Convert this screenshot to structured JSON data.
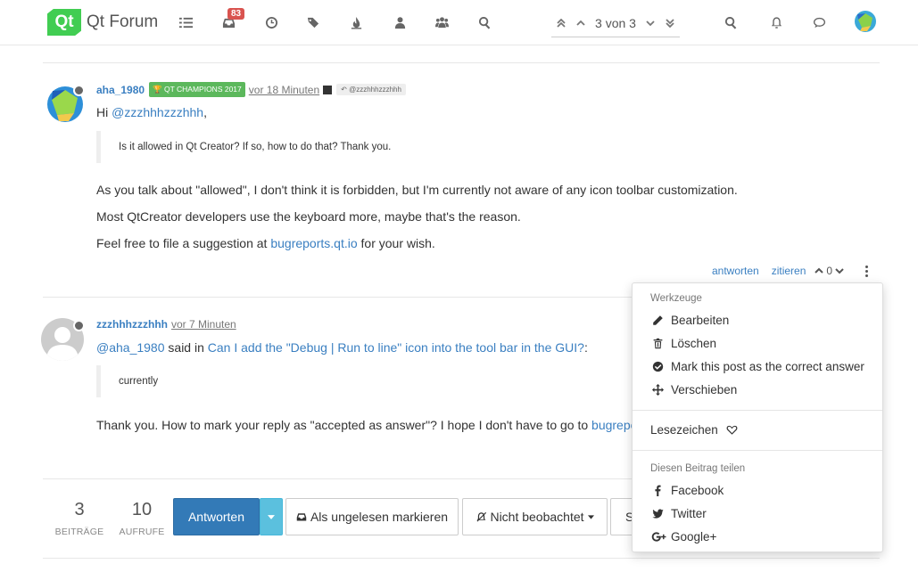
{
  "header": {
    "logo_text": "Qt",
    "brand": "Qt Forum",
    "unread_count": "83",
    "pager_text": "3 von 3"
  },
  "post1": {
    "username": "aha_1980",
    "badge": "QT CHAMPIONS 2017",
    "time": "vor 18 Minuten",
    "reply_to": "@zzzhhhzzzhhh",
    "greeting_prefix": "Hi ",
    "greeting_mention": "@zzzhhhzzzhhh",
    "greeting_suffix": ",",
    "quote": "Is it allowed in Qt Creator? If so, how to do that? Thank you.",
    "para1": "As you talk about \"allowed\", I don't think it is forbidden, but I'm currently not aware of any icon toolbar customization.",
    "para2": "Most QtCreator developers use the keyboard more, maybe that's the reason.",
    "para3_prefix": "Feel free to file a suggestion at ",
    "para3_link": "bugreports.qt.io",
    "para3_suffix": " for your wish.",
    "reply_label": "antworten",
    "quote_label": "zitieren",
    "votes": "0"
  },
  "post2": {
    "username": "zzzhhhzzzhhh",
    "time": "vor 7 Minuten",
    "said_mention": "@aha_1980",
    "said_in": " said in ",
    "said_link": "Can I add the \"Debug | Run to line\" icon into the tool bar in the GUI?",
    "said_colon": ":",
    "quote": "currently",
    "para1_prefix": "Thank you. How to mark your reply as \"accepted as answer\"? I hope I don't have to go to ",
    "para1_link": "bugreports.qt.io"
  },
  "footer": {
    "posts_count": "3",
    "posts_label": "BEITRÄGE",
    "views_count": "10",
    "views_label": "AUFRUFE",
    "reply_button": "Antworten",
    "mark_unread": "Als ungelesen markieren",
    "not_watched": "Nicht beobachtet",
    "sort_partial": "S"
  },
  "dropdown": {
    "tools_header": "Werkzeuge",
    "edit": "Bearbeiten",
    "delete": "Löschen",
    "mark_correct": "Mark this post as the correct answer",
    "move": "Verschieben",
    "bookmark": "Lesezeichen",
    "share_header": "Diesen Beitrag teilen",
    "facebook": "Facebook",
    "twitter": "Twitter",
    "google": "Google+"
  },
  "colors": {
    "qt_green": "#41cd52",
    "link_blue": "#3a7fc1",
    "primary_button": "#337ab7",
    "badge_red": "#d9534f",
    "champion_green": "#5cb85c"
  }
}
